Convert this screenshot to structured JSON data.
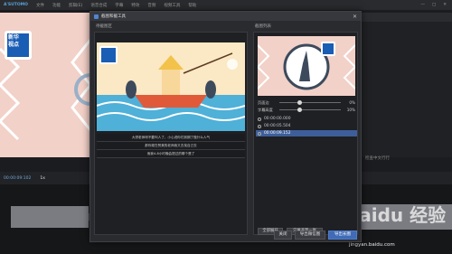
{
  "app": {
    "logo": "A'SUTOMO",
    "menu": [
      "文件",
      "功能",
      "剪辑(E)",
      "语音合成",
      "字幕",
      "特效",
      "音频",
      "视频工具",
      "帮助"
    ],
    "window_controls": [
      "—",
      "□",
      "✕"
    ],
    "right_panel_text": "检查中文行行",
    "timecode": "00:00:09:102",
    "speed": "1x",
    "ruler_label": "00:06:12"
  },
  "dialog": {
    "title": "截图和截工具",
    "close": "✕",
    "left_pane_title": "待截图区",
    "right_pane_title": "截图列表",
    "subtitles": [
      "大饼老师呀不要叫人了，小心说你们到期了做什么人气",
      "那你现在赞美的老师我又去找自己去",
      "而我4-8小时晚会提过的哪个是了"
    ],
    "sliders": [
      {
        "label": "页面边",
        "value": "0%",
        "level": 0.3
      },
      {
        "label": "字幕高度",
        "value": "10%",
        "level": 0.3
      }
    ],
    "timestamps": [
      {
        "text": "00:00:00.000",
        "selected": false
      },
      {
        "text": "00:00:05.504",
        "selected": false
      },
      {
        "text": "00:00:09.152",
        "selected": true
      }
    ],
    "pane_buttons": [
      "全部展开",
      "只展开第一张"
    ],
    "footer_buttons": [
      "关闭",
      "导出微信图",
      "导出长图"
    ],
    "logo_text": {
      "line1": "新华",
      "line2": "视点",
      "sub": "微薄"
    }
  },
  "watermark": {
    "text": "Baidu 经验",
    "url": "jingyan.baidu.com"
  },
  "colors": {
    "accent": "#3f6bb8",
    "selected_row": "#3d5e9a"
  }
}
